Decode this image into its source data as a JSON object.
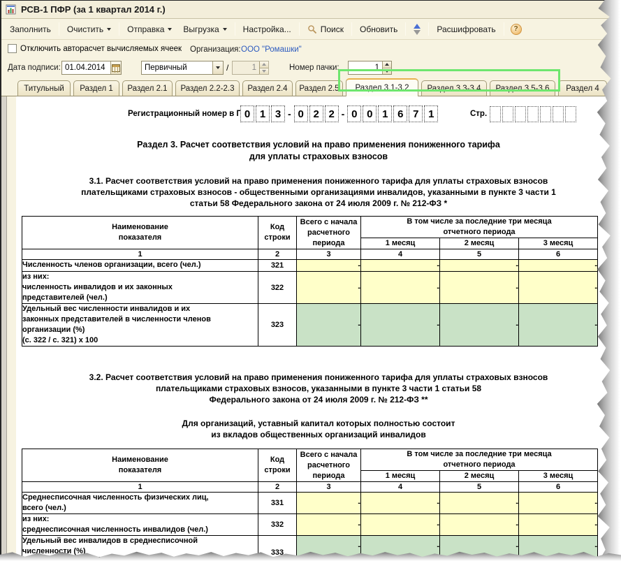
{
  "window": {
    "title": "РСВ-1 ПФР (за 1 квартал 2014 г.)"
  },
  "toolbar": {
    "fill": "Заполнить",
    "clear": "Очистить",
    "send": "Отправка",
    "upload": "Выгрузка",
    "settings": "Настройка...",
    "search": "Поиск",
    "refresh": "Обновить",
    "decrypt": "Расшифровать"
  },
  "form": {
    "autocalc_checkbox_label": "Отключить авторасчет вычисляемых ячеек",
    "organization_label": "Организация:",
    "organization_value": "ООО \"Ромашки\"",
    "sign_date_label": "Дата подписи:",
    "sign_date_value": "01.04.2014",
    "correction_type_value": "Первичный",
    "slash": "/",
    "correction_number_value": "1",
    "batch_number_label": "Номер пачки:",
    "batch_number_value": "1"
  },
  "tabs": [
    "Титульный",
    "Раздел 1",
    "Раздел 2.1",
    "Раздел 2.2-2.3",
    "Раздел 2.4",
    "Раздел 2.5",
    "Раздел 3.1-3.2",
    "Раздел 3.3-3.4",
    "Раздел 3.5-3.6",
    "Раздел 4"
  ],
  "active_tab": "Раздел 3.1-3.2",
  "colors": {
    "highlight_green_box": "#6ee66e",
    "cell_yellow": "#ffffc9",
    "cell_green": "#c9e2c6",
    "organization_link_blue": "#2d5bbf"
  },
  "sheet": {
    "reg_number_label": "Регистрационный номер в ПФР",
    "reg_digits1": [
      "0",
      "1",
      "3"
    ],
    "reg_digits2": [
      "0",
      "2",
      "2"
    ],
    "reg_digits3": [
      "0",
      "0",
      "1",
      "6",
      "7",
      "1"
    ],
    "dash": "-",
    "page_label": "Стр.",
    "section_title": "Раздел 3. Расчет соответствия условий на право применения пониженного тарифа\nдля уплаты страховых взносов",
    "subsection1_text": "3.1. Расчет соответствия условий на право применения пониженного тарифа для уплаты страховых взносов\nплательщиками страховых взносов - общественными организациями инвалидов, указанными в пункте 3 части 1\nстатьи 58 Федерального закона от 24 июля 2009 г. № 212-ФЗ *",
    "subsection2_text": "3.2. Расчет соответствия условий на право применения пониженного тарифа для уплаты страховых взносов\nплательщиками страховых взносов, указанными в пункте 3 части 1 статьи 58\nФедерального закона от 24 июля 2009 г. № 212-ФЗ **",
    "subsection2_note": "Для организаций, уставный капитал которых полностью состоит\nиз вкладов общественных организаций инвалидов",
    "table_header": {
      "col_name": "Наименование\nпоказателя",
      "col_code": "Код\nстроки",
      "col_total": "Всего с начала\nрасчетного\nпериода",
      "col_group": "В том числе за последние три месяца\nотчетного периода",
      "months": [
        "1 месяц",
        "2 месяц",
        "3 месяц"
      ],
      "numbers": [
        "1",
        "2",
        "3",
        "4",
        "5",
        "6"
      ]
    },
    "table1": {
      "rows": [
        {
          "name": "Численность членов организации, всего (чел.)",
          "code": "321",
          "values": [
            "-",
            "-",
            "-",
            "-"
          ]
        },
        {
          "name": "из них:\nчисленность инвалидов и их законных\nпредставителей (чел.)",
          "code": "322",
          "values": [
            "-",
            "-",
            "-",
            "-"
          ]
        },
        {
          "name": "Удельный вес численности инвалидов и их\nзаконных представителей в численности членов\nорганизации (%)\n(с. 322 / с. 321) х 100",
          "code": "323",
          "values": [
            "-",
            "-",
            "-",
            "-"
          ]
        }
      ]
    },
    "table2": {
      "rows": [
        {
          "name": "Среднесписочная численность физических лиц,\nвсего (чел.)",
          "code": "331",
          "values": [
            "-",
            "-",
            "-",
            "-"
          ]
        },
        {
          "name": "из них:\nсреднесписочная численность инвалидов (чел.)",
          "code": "332",
          "values": [
            "-",
            "-",
            "-",
            "-"
          ]
        },
        {
          "name": "Удельный вес инвалидов в среднесписочной\nчисленности (%)",
          "code": "333",
          "values": [
            "-",
            "-",
            "-",
            "-"
          ]
        }
      ]
    }
  }
}
